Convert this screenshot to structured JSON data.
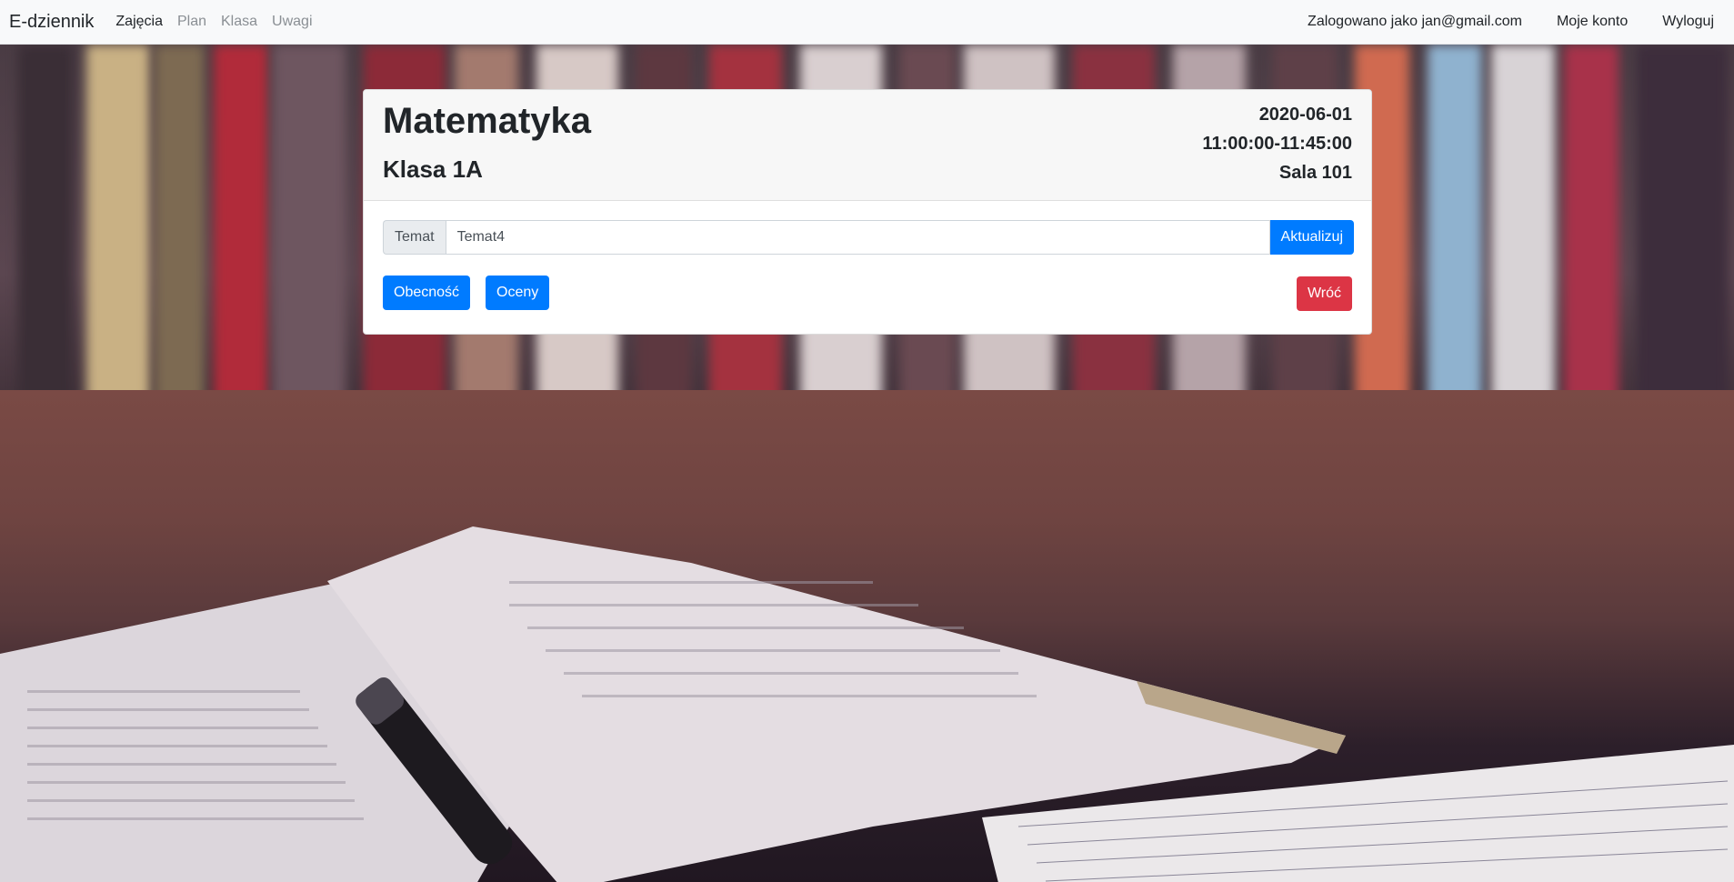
{
  "navbar": {
    "brand": "E-dziennik",
    "links": [
      "Zajęcia",
      "Plan",
      "Klasa",
      "Uwagi"
    ],
    "user_text": "Zalogowano jako jan@gmail.com",
    "account": "Moje konto",
    "logout": "Wyloguj"
  },
  "lesson": {
    "subject": "Matematyka",
    "class": "Klasa 1A",
    "date": "2020-06-01",
    "time": "11:00:00-11:45:00",
    "room": "Sala 101"
  },
  "topic": {
    "label": "Temat",
    "value": "Temat4",
    "update_label": "Aktualizuj"
  },
  "actions": {
    "attendance": "Obecność",
    "grades": "Oceny",
    "back": "Wróć"
  },
  "colors": {
    "primary": "#007bff",
    "danger": "#dc3545",
    "navbar_bg": "#f8f9fa"
  }
}
